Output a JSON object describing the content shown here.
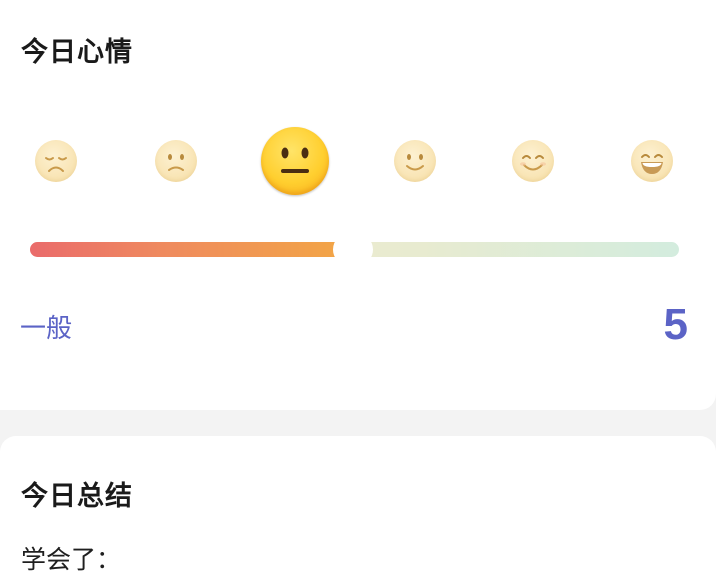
{
  "mood": {
    "title": "今日心情",
    "faces": [
      {
        "icon": "sad-face-icon"
      },
      {
        "icon": "slightly-frowning-face-icon"
      },
      {
        "icon": "neutral-face-icon",
        "selected": true
      },
      {
        "icon": "slightly-smiling-face-icon"
      },
      {
        "icon": "smiling-face-icon"
      },
      {
        "icon": "grinning-face-icon"
      }
    ],
    "label": "一般",
    "score": "5",
    "level_percent": 47
  },
  "summary": {
    "title": "今日总结",
    "learned_label": "学会了："
  },
  "colors": {
    "accent": "#5b63c6",
    "slider_start": "#ea6b6b",
    "slider_end": "#f2a447"
  }
}
